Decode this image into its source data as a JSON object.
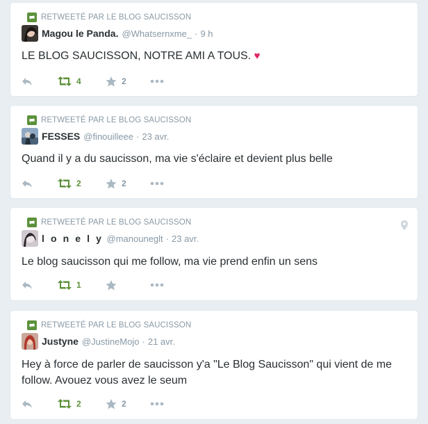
{
  "colors": {
    "retweet_green": "#5c913b",
    "muted": "#8899a6",
    "heart": "#e0245e"
  },
  "tweets": [
    {
      "retweet_context": "RETWEETÉ PAR LE BLOG SAUCISSON",
      "fullname": "Magou le Panda.",
      "handle": "@Whatsernxme_",
      "separator": "·",
      "time": "9 h",
      "text": "LE BLOG SAUCISSON, NOTRE AMI A TOUS.",
      "emoji": "♥",
      "retweet_count": "4",
      "favorite_count": "2",
      "avatar_icon": "avatar-dark-hair"
    },
    {
      "retweet_context": "RETWEETÉ PAR LE BLOG SAUCISSON",
      "fullname": "FESSES",
      "handle": "@finouilleee",
      "separator": "·",
      "time": "23 avr.",
      "text": "Quand il y a du saucisson, ma vie s'éclaire et devient plus belle",
      "retweet_count": "2",
      "favorite_count": "2",
      "avatar_icon": "avatar-blue-figure"
    },
    {
      "retweet_context": "RETWEETÉ PAR LE BLOG SAUCISSON",
      "fullname": "l o n e l y",
      "handle": "@manouneglt",
      "separator": "·",
      "time": "23 avr.",
      "text": "Le blog saucisson qui me follow, ma vie prend enfin un sens",
      "retweet_count": "1",
      "favorite_count": "",
      "avatar_icon": "avatar-light-face",
      "has_geo": true
    },
    {
      "retweet_context": "RETWEETÉ PAR LE BLOG SAUCISSON",
      "fullname": "Justyne",
      "handle": "@JustineMojo",
      "separator": "·",
      "time": "21 avr.",
      "text": "Hey à force de parler de saucisson y'a \"Le Blog Saucisson\" qui vient de me follow. Avouez vous avez le seum",
      "retweet_count": "2",
      "favorite_count": "2",
      "avatar_icon": "avatar-red-hair"
    }
  ]
}
